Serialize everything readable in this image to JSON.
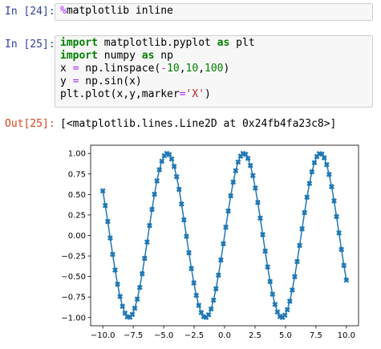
{
  "cells": [
    {
      "prompt": "In [24]:",
      "code": [
        [
          {
            "t": "%",
            "c": "mg"
          },
          {
            "t": "matplotlib inline",
            "c": ""
          }
        ]
      ]
    },
    {
      "prompt": "In [25]:",
      "code": [
        [
          {
            "t": "import",
            "c": "kw"
          },
          {
            "t": " matplotlib.pyplot ",
            "c": ""
          },
          {
            "t": "as",
            "c": "kw"
          },
          {
            "t": " plt",
            "c": ""
          }
        ],
        [
          {
            "t": "import",
            "c": "kw"
          },
          {
            "t": " numpy ",
            "c": ""
          },
          {
            "t": "as",
            "c": "kw"
          },
          {
            "t": " np",
            "c": ""
          }
        ],
        [
          {
            "t": "x ",
            "c": ""
          },
          {
            "t": "=",
            "c": "op"
          },
          {
            "t": " np.linspace(",
            "c": ""
          },
          {
            "t": "-",
            "c": "op"
          },
          {
            "t": "10",
            "c": "num"
          },
          {
            "t": ",",
            "c": ""
          },
          {
            "t": "10",
            "c": "num"
          },
          {
            "t": ",",
            "c": ""
          },
          {
            "t": "100",
            "c": "num"
          },
          {
            "t": ")",
            "c": ""
          }
        ],
        [
          {
            "t": "y ",
            "c": ""
          },
          {
            "t": "=",
            "c": "op"
          },
          {
            "t": " np.sin(x)",
            "c": ""
          }
        ],
        [
          {
            "t": "plt.plot(x,y,marker",
            "c": ""
          },
          {
            "t": "=",
            "c": "op"
          },
          {
            "t": "'X'",
            "c": "str"
          },
          {
            "t": ")",
            "c": ""
          }
        ]
      ]
    }
  ],
  "output": {
    "prompt": "Out[25]:",
    "text": "[<matplotlib.lines.Line2D at 0x24fb4fa23c8>]"
  },
  "chart_data": {
    "type": "line",
    "title": "",
    "xlabel": "",
    "ylabel": "",
    "series": [
      {
        "function": "sin",
        "x_start": -10,
        "x_end": 10,
        "num_points": 100,
        "marker": "X",
        "color": "#1f77b4"
      }
    ],
    "xlim": [
      -11,
      11
    ],
    "ylim": [
      -1.1,
      1.1
    ],
    "xticks": [
      -10.0,
      -7.5,
      -5.0,
      -2.5,
      0.0,
      2.5,
      5.0,
      7.5,
      10.0
    ],
    "xtick_labels": [
      "−10.0",
      "−7.5",
      "−5.0",
      "−2.5",
      "0.0",
      "2.5",
      "5.0",
      "7.5",
      "10.0"
    ],
    "yticks": [
      1.0,
      0.75,
      0.5,
      0.25,
      0.0,
      -0.25,
      -0.5,
      -0.75,
      -1.0
    ],
    "ytick_labels": [
      "1.00",
      "0.75",
      "0.50",
      "0.25",
      "0.00",
      "−0.25",
      "−0.50",
      "−0.75",
      "−1.00"
    ],
    "grid": false,
    "legend": "none"
  }
}
